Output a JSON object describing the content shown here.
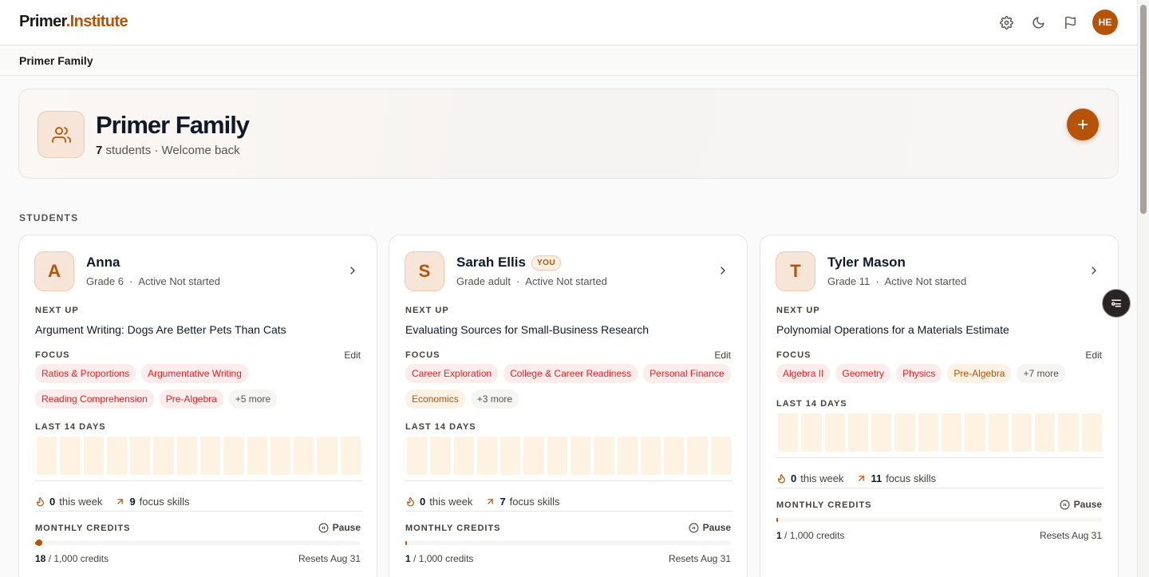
{
  "app": {
    "logo_main": "Primer",
    "logo_accent": ".Institute",
    "user_initials": "HE"
  },
  "subbar": {
    "title": "Primer Family"
  },
  "hero": {
    "title": "Primer Family",
    "student_count": "7",
    "subtitle_rest": "students · Welcome back"
  },
  "section": {
    "students_label": "STUDENTS"
  },
  "colors": {
    "accent": "#b45309",
    "tag_red_text": "#dc2626",
    "tag_red_bg": "#fdecec",
    "bar_bg": "#fef3e2"
  },
  "labels": {
    "next_up": "NEXT UP",
    "focus": "FOCUS",
    "edit": "Edit",
    "last_14_days": "LAST 14 DAYS",
    "this_week": "this week",
    "focus_skills": "focus skills",
    "monthly_credits": "MONTHLY CREDITS",
    "pause": "Pause",
    "credits_suffix": "/ 1,000 credits",
    "you_badge": "YOU"
  },
  "students": [
    {
      "initial": "A",
      "name": "Anna",
      "grade": "Grade 6",
      "status": "Active Not started",
      "next_up": "Argument Writing: Dogs Are Better Pets Than Cats",
      "tags": [
        "Ratios & Proportions",
        "Argumentative Writing",
        "Reading Comprehension",
        "Pre-Algebra",
        "+5 more"
      ],
      "this_week": "0",
      "focus_skills": "9",
      "credits_used": "18",
      "credits_fraction": 0.018,
      "resets": "Resets Aug 31"
    },
    {
      "initial": "S",
      "name": "Sarah Ellis",
      "is_you": true,
      "grade": "Grade adult",
      "status": "Active Not started",
      "next_up": "Evaluating Sources for Small-Business Research",
      "tags": [
        "Career Exploration",
        "College & Career Readiness",
        "Personal Finance",
        "Economics",
        "+3 more"
      ],
      "this_week": "0",
      "focus_skills": "7",
      "credits_used": "1",
      "credits_fraction": 0.001,
      "resets": "Resets Aug 31"
    },
    {
      "initial": "T",
      "name": "Tyler Mason",
      "grade": "Grade 11",
      "status": "Active Not started",
      "next_up": "Polynomial Operations for a Materials Estimate",
      "tags": [
        "Algebra II",
        "Geometry",
        "Physics",
        "Pre-Algebra",
        "+7 more"
      ],
      "this_week": "0",
      "focus_skills": "11",
      "credits_used": "1",
      "credits_fraction": 0.001,
      "resets": "Resets Aug 31"
    }
  ]
}
